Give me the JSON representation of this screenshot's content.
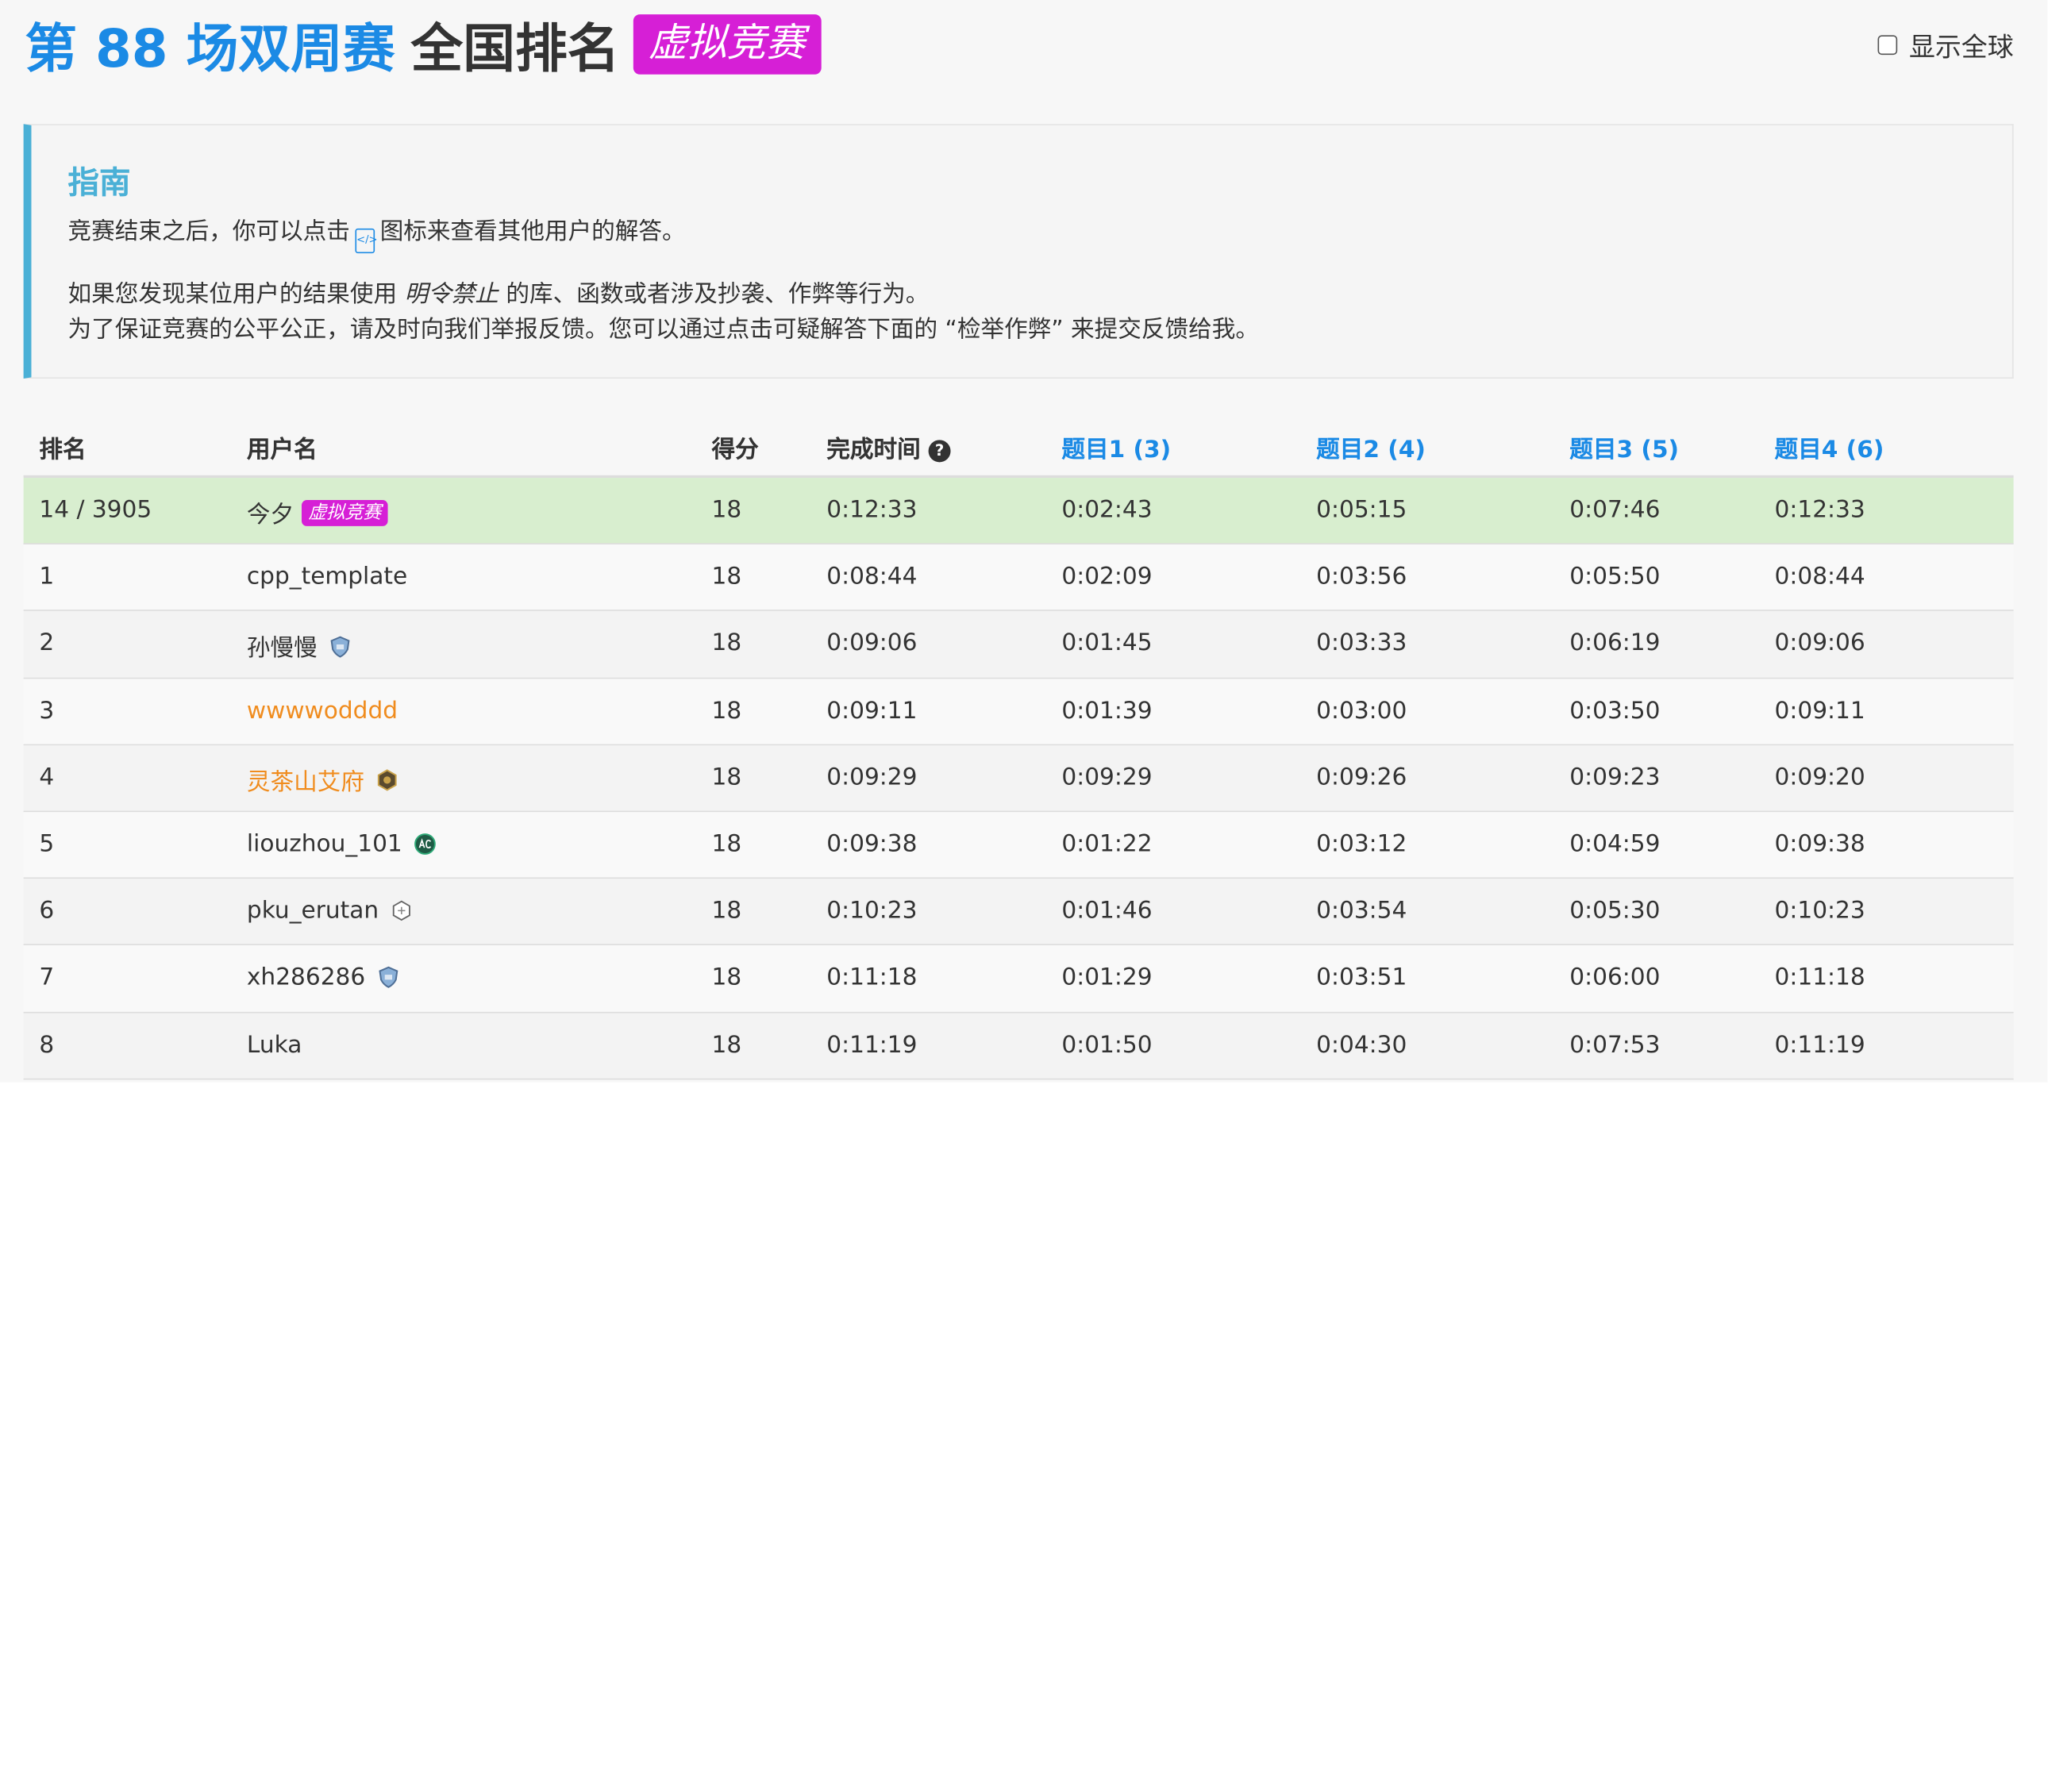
{
  "header": {
    "contest_title": "第 88 场双周赛",
    "rank_title": "全国排名",
    "virtual_badge": "虚拟竞赛",
    "global_toggle_label": "显示全球",
    "global_toggle_checked": false
  },
  "guide": {
    "title": "指南",
    "line1_before": "竞赛结束之后，你可以点击",
    "line1_after": "图标来查看其他用户的解答。",
    "line2_before": "如果您发现某位用户的结果使用",
    "line2_emph": "明令禁止",
    "line2_after": "的库、函数或者涉及抄袭、作弊等行为。",
    "line3": "为了保证竞赛的公平公正，请及时向我们举报反馈。您可以通过点击可疑解答下面的 “检举作弊” 来提交反馈给我。"
  },
  "table": {
    "headers": {
      "rank": "排名",
      "user": "用户名",
      "score": "得分",
      "time": "完成时间",
      "q1": "题目1 (3)",
      "q2": "题目2 (4)",
      "q3": "题目3 (5)",
      "q4": "题目4 (6)"
    },
    "rows": [
      {
        "rank": "14 / 3905",
        "user": "今夕",
        "badge": "虚拟竞赛",
        "score": "18",
        "time": "0:12:33",
        "q1": "0:02:43",
        "q2": "0:05:15",
        "q3": "0:07:46",
        "q4": "0:12:33"
      },
      {
        "rank": "1",
        "user": "cpp_template",
        "score": "18",
        "time": "0:08:44",
        "q1": "0:02:09",
        "q2": "0:03:56",
        "q3": "0:05:50",
        "q4": "0:08:44"
      },
      {
        "rank": "2",
        "user": "孙慢慢",
        "icon": "shield-badge-icon",
        "score": "18",
        "time": "0:09:06",
        "q1": "0:01:45",
        "q2": "0:03:33",
        "q3": "0:06:19",
        "q4": "0:09:06"
      },
      {
        "rank": "3",
        "user": "wwwwodddd",
        "score": "18",
        "time": "0:09:11",
        "q1": "0:01:39",
        "q2": "0:03:00",
        "q3": "0:03:50",
        "q4": "0:09:11"
      },
      {
        "rank": "4",
        "user": "灵茶山艾府",
        "icon": "hexagon-badge-icon",
        "score": "18",
        "time": "0:09:29",
        "q1": "0:09:29",
        "q2": "0:09:26",
        "q3": "0:09:23",
        "q4": "0:09:20"
      },
      {
        "rank": "5",
        "user": "liouzhou_101",
        "icon": "ac-badge-icon",
        "score": "18",
        "time": "0:09:38",
        "q1": "0:01:22",
        "q2": "0:03:12",
        "q3": "0:04:59",
        "q4": "0:09:38"
      },
      {
        "rank": "6",
        "user": "pku_erutan",
        "icon": "hexagon-outline-icon",
        "score": "18",
        "time": "0:10:23",
        "q1": "0:01:46",
        "q2": "0:03:54",
        "q3": "0:05:30",
        "q4": "0:10:23"
      },
      {
        "rank": "7",
        "user": "xh286286",
        "icon": "shield-badge-icon",
        "score": "18",
        "time": "0:11:18",
        "q1": "0:01:29",
        "q2": "0:03:51",
        "q3": "0:06:00",
        "q4": "0:11:18"
      },
      {
        "rank": "8",
        "user": "Luka",
        "score": "18",
        "time": "0:11:19",
        "q1": "0:01:50",
        "q2": "0:04:30",
        "q3": "0:07:53",
        "q4": "0:11:19"
      }
    ]
  },
  "colors": {
    "link_blue": "#1b8ae5",
    "virtual_magenta": "#d61fd6",
    "guide_accent": "#4ab0d6",
    "highlight_row": "#d8eecf",
    "orange_user": "#f08c1e"
  }
}
